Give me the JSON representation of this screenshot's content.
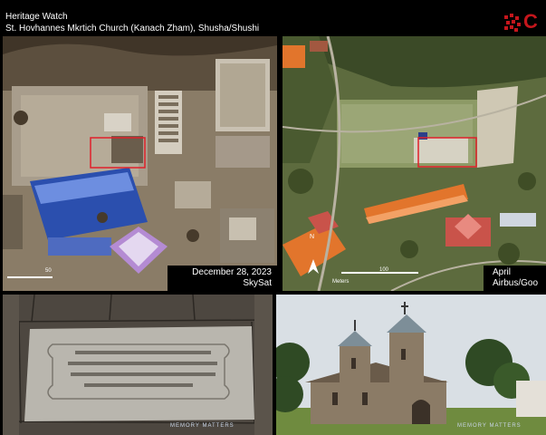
{
  "header": {
    "title": "Heritage Watch",
    "subtitle": "St. Hovhannes Mkrtich Church (Kanach Zham), Shusha/Shushi",
    "brand_letter": "C"
  },
  "panels": {
    "top_left": {
      "date": "December 28, 2023",
      "source": "SkySat",
      "scale_label": "50"
    },
    "top_right": {
      "date": "April",
      "source": "Airbus/Goo",
      "scale_label": "100",
      "scale_unit": "Meters",
      "north": "N"
    },
    "bottom_left": {
      "watermark": "MEMORY MATTERS"
    },
    "bottom_right": {
      "watermark": "MEMORY MATTERS"
    }
  },
  "colors": {
    "highlight_box": "#e0202a",
    "brand": "#c4161c",
    "header_bg": "#000000"
  }
}
